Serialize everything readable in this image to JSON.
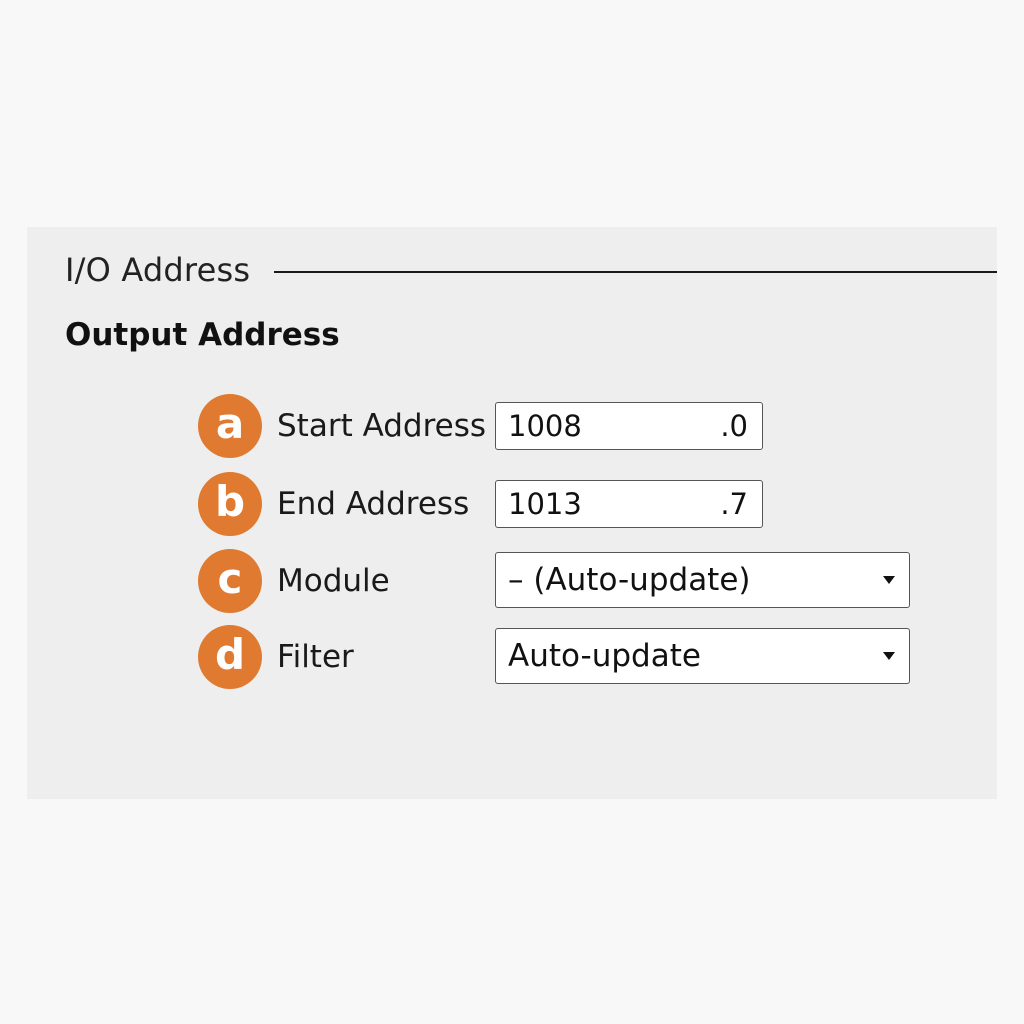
{
  "io_group": {
    "title": "I/O Address"
  },
  "output_section": {
    "title": "Output Address"
  },
  "accent_color": "#e07a30",
  "rows": [
    {
      "marker": "a",
      "label": "Start Address",
      "value": "1008",
      "bit": ".0"
    },
    {
      "marker": "b",
      "label": "End Address",
      "value": "1013",
      "bit": ".7"
    },
    {
      "marker": "c",
      "label": "Module",
      "selected": "– (Auto-update)",
      "icon": "dropdown-arrow-icon"
    },
    {
      "marker": "d",
      "label": "Filter",
      "selected": "Auto-update",
      "icon": "dropdown-arrow-icon"
    }
  ]
}
